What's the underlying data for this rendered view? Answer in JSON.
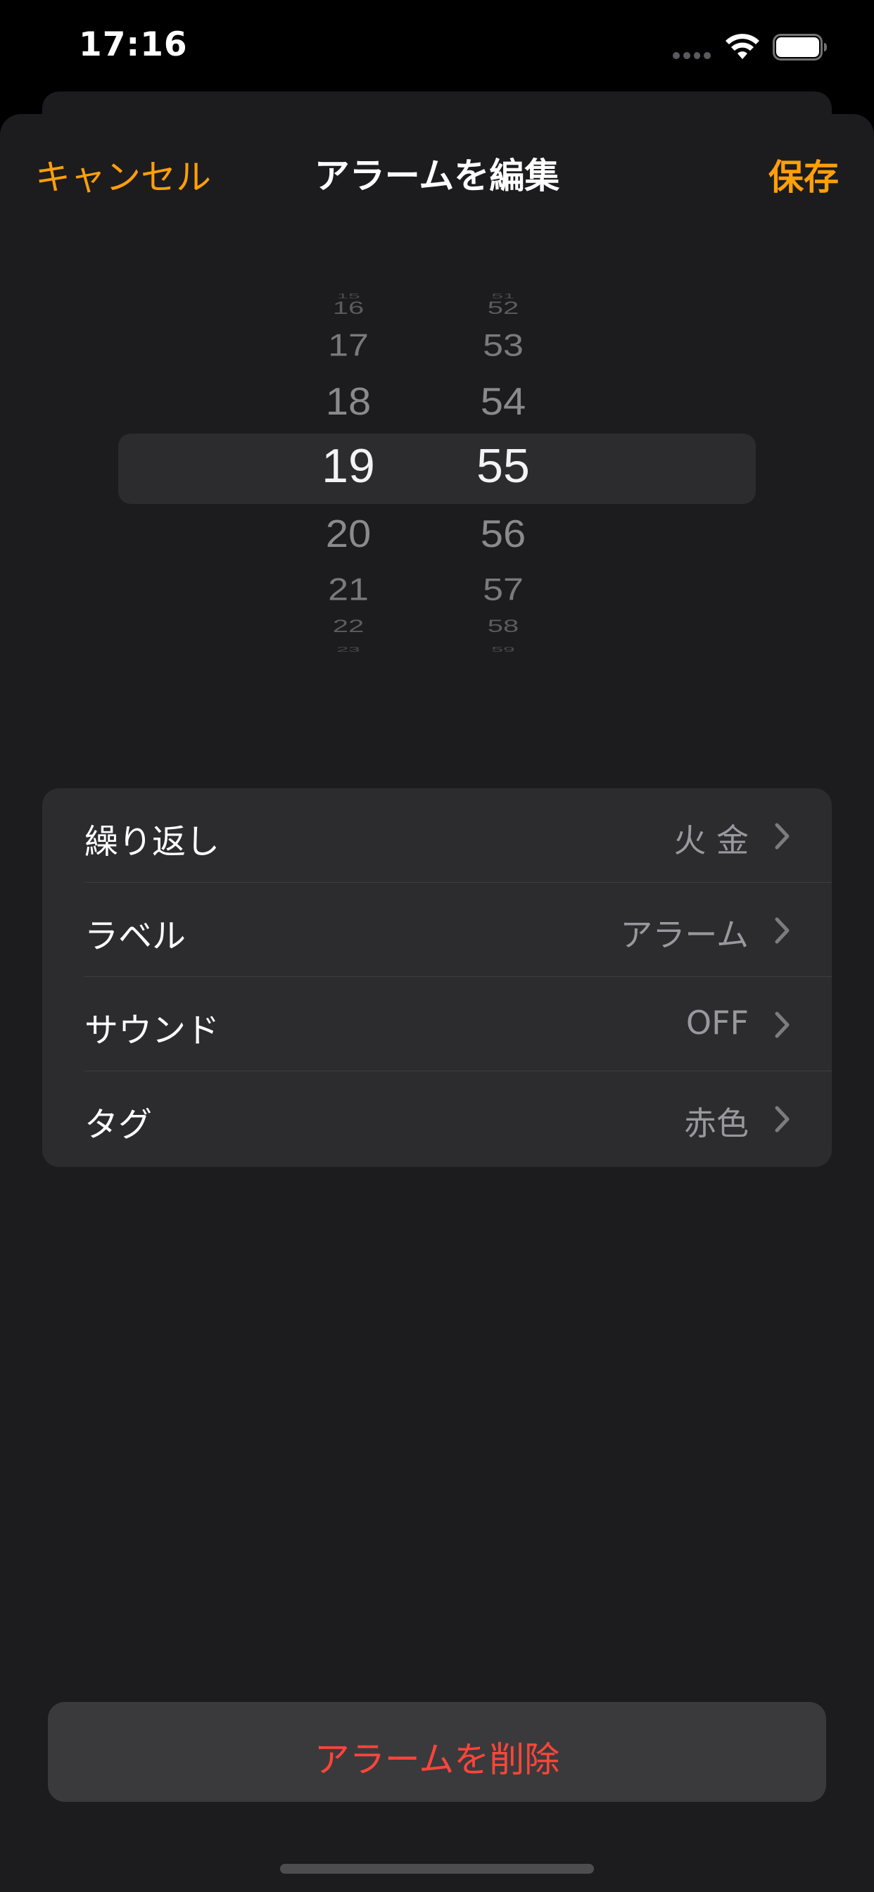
{
  "status_bar": {
    "time": "17:16",
    "icons": [
      "signal-dots-icon",
      "wifi-icon",
      "battery-icon"
    ]
  },
  "nav": {
    "cancel_label": "キャンセル",
    "title": "アラームを編集",
    "save_label": "保存"
  },
  "time_picker": {
    "hours": [
      "15",
      "16",
      "17",
      "18",
      "19",
      "20",
      "21",
      "22",
      "23"
    ],
    "minutes": [
      "51",
      "52",
      "53",
      "54",
      "55",
      "56",
      "57",
      "58",
      "59"
    ],
    "selected_hour": "19",
    "selected_minute": "55"
  },
  "settings": {
    "rows": [
      {
        "label": "繰り返し",
        "value": "火 金"
      },
      {
        "label": "ラベル",
        "value": "アラーム"
      },
      {
        "label": "サウンド",
        "value": "OFF"
      },
      {
        "label": "タグ",
        "value": "赤色"
      }
    ]
  },
  "delete_button": {
    "label": "アラームを削除"
  },
  "colors": {
    "accent": "#ff9f0a",
    "destructive": "#ff453a",
    "sheet_background": "#1c1c1e",
    "grouped_background": "#2c2c2e"
  }
}
